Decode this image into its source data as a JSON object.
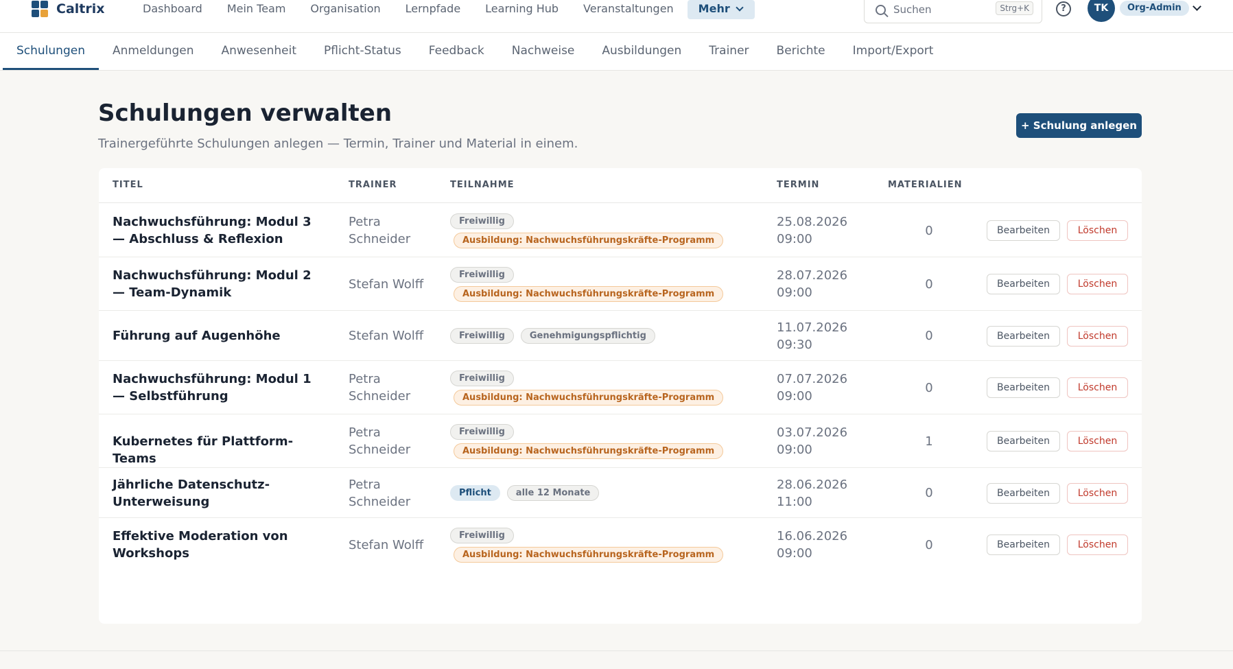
{
  "brand": {
    "name": "Caltrix",
    "logo_colors": [
      "#1e4f7a",
      "#1e4f7a",
      "#1e4f7a",
      "#e8a23a"
    ]
  },
  "main_nav": [
    {
      "label": "Dashboard"
    },
    {
      "label": "Mein Team"
    },
    {
      "label": "Organisation"
    },
    {
      "label": "Lernpfade"
    },
    {
      "label": "Learning Hub"
    },
    {
      "label": "Veranstaltungen"
    },
    {
      "label": "Mehr",
      "active": true
    }
  ],
  "search": {
    "placeholder": "Suchen",
    "shortcut": "Strg+K"
  },
  "user": {
    "initials": "TK",
    "role": "Org-Admin"
  },
  "sub_nav": [
    {
      "label": "Schulungen",
      "active": true
    },
    {
      "label": "Anmeldungen"
    },
    {
      "label": "Anwesenheit"
    },
    {
      "label": "Pflicht-Status"
    },
    {
      "label": "Feedback"
    },
    {
      "label": "Nachweise"
    },
    {
      "label": "Ausbildungen"
    },
    {
      "label": "Trainer"
    },
    {
      "label": "Berichte"
    },
    {
      "label": "Import/Export"
    }
  ],
  "page": {
    "title": "Schulungen verwalten",
    "subtitle": "Trainergeführte Schulungen anlegen — Termin, Trainer und Material in einem.",
    "create_button": "+ Schulung anlegen"
  },
  "table": {
    "columns": {
      "title": "TITEL",
      "trainer": "TRAINER",
      "participation": "TEILNAHME",
      "date": "TERMIN",
      "materials": "MATERIALIEN"
    },
    "edit_label": "Bearbeiten",
    "delete_label": "Löschen",
    "rows": [
      {
        "title": "Nachwuchsführung: Modul 3 — Abschluss & Reflexion",
        "trainer": "Petra Schneider",
        "tags": [
          {
            "text": "Freiwillig",
            "style": "grey"
          },
          {
            "text": "Ausbildung: Nachwuchsführungskräfte-Programm",
            "style": "orange"
          }
        ],
        "date": "25.08.2026",
        "time": "09:00",
        "materials": "0"
      },
      {
        "title": "Nachwuchsführung: Modul 2 — Team-Dynamik",
        "trainer": "Stefan Wolff",
        "tags": [
          {
            "text": "Freiwillig",
            "style": "grey"
          },
          {
            "text": "Ausbildung: Nachwuchsführungskräfte-Programm",
            "style": "orange"
          }
        ],
        "date": "28.07.2026",
        "time": "09:00",
        "materials": "0"
      },
      {
        "title": "Führung auf Augenhöhe",
        "trainer": "Stefan Wolff",
        "tags": [
          {
            "text": "Freiwillig",
            "style": "grey"
          },
          {
            "text": "Genehmigungspflichtig",
            "style": "grey"
          }
        ],
        "date": "11.07.2026",
        "time": "09:30",
        "materials": "0"
      },
      {
        "title": "Nachwuchsführung: Modul 1 — Selbstführung",
        "trainer": "Petra Schneider",
        "tags": [
          {
            "text": "Freiwillig",
            "style": "grey"
          },
          {
            "text": "Ausbildung: Nachwuchsführungskräfte-Programm",
            "style": "orange"
          }
        ],
        "date": "07.07.2026",
        "time": "09:00",
        "materials": "0"
      },
      {
        "title": "Kubernetes für Plattform-Teams",
        "trainer": "Petra Schneider",
        "tags": [
          {
            "text": "Freiwillig",
            "style": "grey"
          },
          {
            "text": "Ausbildung: Nachwuchsführungskräfte-Programm",
            "style": "orange"
          }
        ],
        "date": "03.07.2026",
        "time": "09:00",
        "materials": "1"
      },
      {
        "title": "Jährliche Datenschutz-Unterweisung",
        "trainer": "Petra Schneider",
        "tags": [
          {
            "text": "Pflicht",
            "style": "blue"
          },
          {
            "text": "alle 12 Monate",
            "style": "grey"
          }
        ],
        "date": "28.06.2026",
        "time": "11:00",
        "materials": "0"
      },
      {
        "title": "Effektive Moderation von Workshops",
        "trainer": "Stefan Wolff",
        "tags": [
          {
            "text": "Freiwillig",
            "style": "grey"
          },
          {
            "text": "Ausbildung: Nachwuchsführungskräfte-Programm",
            "style": "orange"
          }
        ],
        "date": "16.06.2026",
        "time": "09:00",
        "materials": "0"
      }
    ]
  }
}
